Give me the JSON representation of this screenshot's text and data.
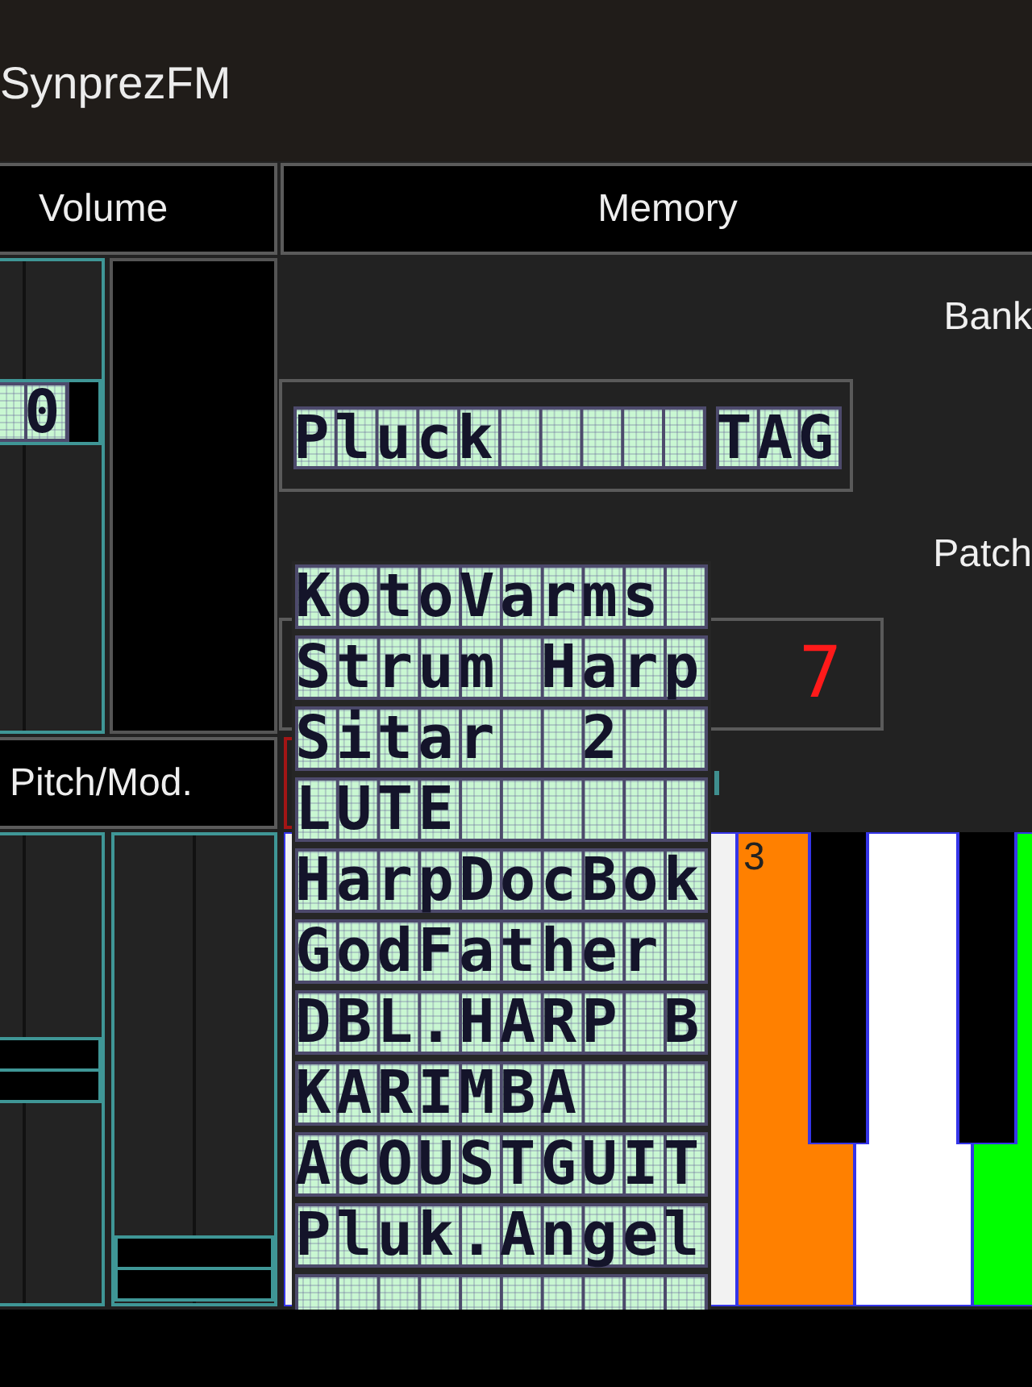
{
  "app_bar": {
    "title": "SynprezFM"
  },
  "volume": {
    "header": "Volume",
    "slider": {
      "level": 0.71,
      "reading": "0"
    }
  },
  "memory": {
    "header": "Memory",
    "bank_label": "Bank",
    "patch_name": "Pluck",
    "tag": "TAG",
    "patch_label": "Patch",
    "patch_number": "7"
  },
  "pitch_mod": {
    "header": "Pitch/Mod.",
    "pitch_slider": {
      "level": 0.5
    },
    "mod_slider": {
      "level": 0
    }
  },
  "keyboard": {
    "keys": [
      {
        "kind": "white",
        "color": "#f2f2f2"
      },
      {
        "kind": "white",
        "color": "#ff8000",
        "label": "3"
      },
      {
        "kind": "black",
        "color": "#000000"
      },
      {
        "kind": "white",
        "color": "#ffffff"
      },
      {
        "kind": "black",
        "color": "#000000"
      },
      {
        "kind": "white",
        "color": "#00ff00"
      }
    ]
  },
  "patch_list": {
    "items": [
      "KotoVarms",
      "Strum Harp",
      "Sitar  2",
      "LUTE",
      "HarpDocBok",
      "GodFather",
      "DBL.HARP B",
      "KARIMBA",
      "ACOUSTGUIT",
      "Pluk.Angel"
    ]
  }
}
